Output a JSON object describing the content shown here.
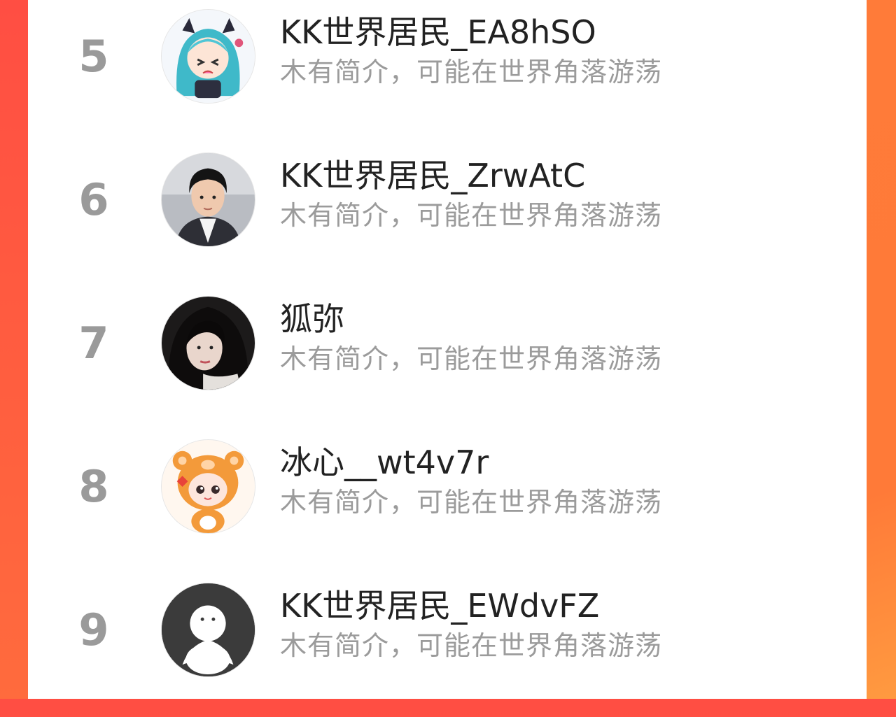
{
  "colors": {
    "background_left": "#ff4e43",
    "background_right": "#ff7b39",
    "panel": "#ffffff",
    "rank_text": "#9a9a9a",
    "name_text": "#222222",
    "bio_text": "#9b9b9b"
  },
  "ranking": {
    "items": [
      {
        "rank": "5",
        "name": "KK世界居民_EA8hSO",
        "bio": "木有简介，可能在世界角落游荡",
        "avatar": "anime-girl-avatar"
      },
      {
        "rank": "6",
        "name": "KK世界居民_ZrwAtC",
        "bio": "木有简介，可能在世界角落游荡",
        "avatar": "young-man-photo-avatar"
      },
      {
        "rank": "7",
        "name": "狐弥",
        "bio": "木有简介，可能在世界角落游荡",
        "avatar": "girl-photo-avatar"
      },
      {
        "rank": "8",
        "name": "冰心__wt4v7r",
        "bio": "木有简介，可能在世界角落游荡",
        "avatar": "bear-costume-cartoon-avatar"
      },
      {
        "rank": "9",
        "name": "KK世界居民_EWdvFZ",
        "bio": "木有简介，可能在世界角落游荡",
        "avatar": "default-ghost-avatar"
      }
    ]
  }
}
